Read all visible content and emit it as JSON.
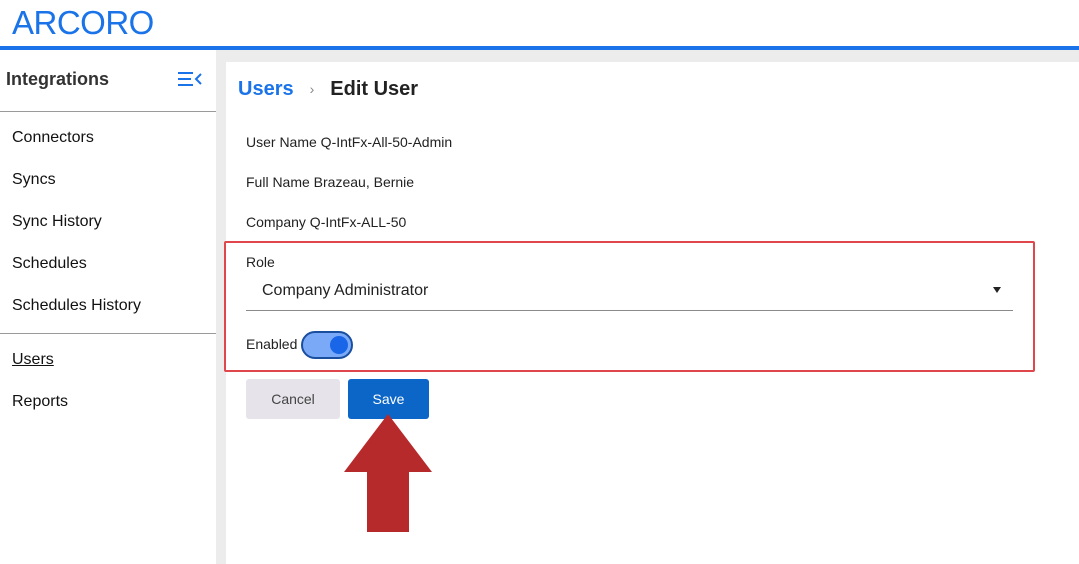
{
  "brand": {
    "logo_text": "ARCORO",
    "accent_color": "#1a73e8"
  },
  "sidebar": {
    "title": "Integrations",
    "collapse_icon": "menu-collapse-icon",
    "items": [
      {
        "label": "Connectors"
      },
      {
        "label": "Syncs"
      },
      {
        "label": "Sync History"
      },
      {
        "label": "Schedules"
      },
      {
        "label": "Schedules History"
      },
      {
        "label": "Users",
        "active": true
      },
      {
        "label": "Reports"
      }
    ]
  },
  "breadcrumb": {
    "parent": "Users",
    "separator": "›",
    "current": "Edit User"
  },
  "user": {
    "user_name_line": "User Name Q-IntFx-All-50-Admin",
    "full_name_line": "Full Name Brazeau, Bernie",
    "company_line": "Company Q-IntFx-ALL-50"
  },
  "form": {
    "role_label": "Role",
    "role_value": "Company Administrator",
    "enabled_label": "Enabled",
    "enabled": true
  },
  "actions": {
    "cancel_label": "Cancel",
    "save_label": "Save"
  },
  "annotation": {
    "highlight_color": "#e0474c",
    "arrow_color": "#b72a2b"
  }
}
